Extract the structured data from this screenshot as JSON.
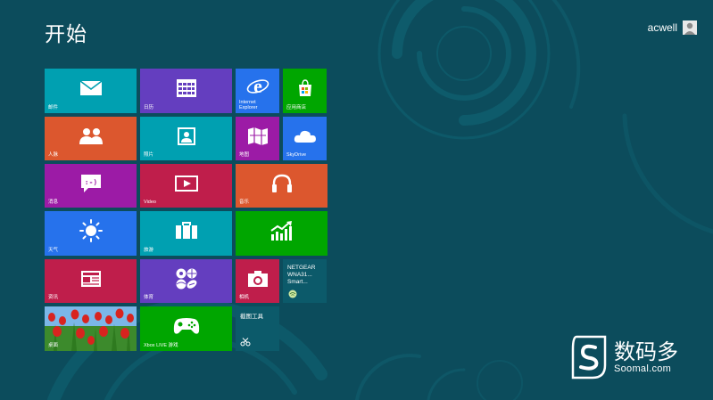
{
  "screen": {
    "title": "开始"
  },
  "user": {
    "name": "acwell",
    "icon": "user-avatar-icon"
  },
  "colors": {
    "background": "#0c4c5c",
    "teal": "#00a0b1",
    "purple": "#643ebf",
    "blue": "#2672ec",
    "green": "#00a600",
    "orange": "#dc572e",
    "magenta": "#9c1ba6",
    "crimson": "#bf1e4b",
    "dark_teal": "#0c5a6a"
  },
  "tiles": {
    "mail": {
      "label": "邮件",
      "icon": "mail-icon"
    },
    "calendar": {
      "label": "日历",
      "icon": "calendar-icon"
    },
    "ie": {
      "label_line1": "Internet",
      "label_line2": "Explorer",
      "icon": "internet-explorer-icon"
    },
    "store": {
      "label": "应用商店",
      "icon": "store-bag-icon"
    },
    "people": {
      "label": "人脉",
      "icon": "people-icon"
    },
    "photos": {
      "label": "照片",
      "icon": "photos-icon"
    },
    "maps": {
      "label": "地图",
      "icon": "map-icon"
    },
    "skydrive": {
      "label": "SkyDrive",
      "icon": "cloud-icon"
    },
    "messaging": {
      "label": "消息",
      "icon": "message-icon"
    },
    "video": {
      "label": "Video",
      "icon": "video-icon"
    },
    "music": {
      "label": "音乐",
      "icon": "headphones-icon"
    },
    "weather": {
      "label": "天气",
      "icon": "sun-icon"
    },
    "travel": {
      "label": "旅游",
      "icon": "suitcase-icon"
    },
    "finance": {
      "label": "",
      "icon": "chart-up-icon"
    },
    "news": {
      "label": "资讯",
      "icon": "newspaper-icon"
    },
    "sports": {
      "label": "体育",
      "icon": "sports-balls-icon"
    },
    "camera": {
      "label": "相机",
      "icon": "camera-icon"
    },
    "netgear": {
      "line1": "NETGEAR",
      "line2": "WNA31...",
      "line3": "Smart...",
      "icon": "network-adapter-icon"
    },
    "desktop": {
      "label": "桌面",
      "icon": "tulips-wallpaper-icon"
    },
    "xbox": {
      "label": "Xbox LIVE 游戏",
      "icon": "xbox-controller-icon"
    },
    "snipping": {
      "title": "截图工具",
      "icon": "scissors-icon"
    }
  },
  "watermark": {
    "cn": "数码多",
    "url": "Soomal.com",
    "icon": "soomal-logo-icon"
  }
}
